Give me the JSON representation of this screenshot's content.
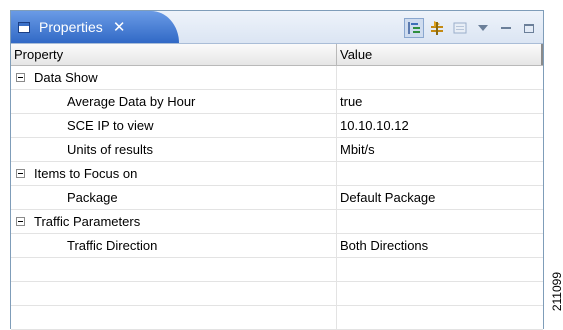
{
  "view": {
    "tab_title": "Properties",
    "close_glyph": "✕"
  },
  "toolbar": {
    "icons": [
      "categories-icon",
      "filter-advanced-icon",
      "restore-defaults-icon",
      "view-menu-icon",
      "minimize-icon",
      "maximize-icon"
    ]
  },
  "table": {
    "headers": {
      "property": "Property",
      "value": "Value"
    },
    "groups": [
      {
        "label": "Data Show",
        "rows": [
          {
            "property": "Average Data by Hour",
            "value": "true"
          },
          {
            "property": "SCE IP to view",
            "value": "10.10.10.12"
          },
          {
            "property": "Units of results",
            "value": "Mbit/s"
          }
        ]
      },
      {
        "label": "Items to Focus on",
        "rows": [
          {
            "property": "Package",
            "value": "Default Package"
          }
        ]
      },
      {
        "label": "Traffic Parameters",
        "rows": [
          {
            "property": "Traffic Direction",
            "value": "Both Directions"
          }
        ]
      }
    ]
  },
  "figure_id": "211099"
}
